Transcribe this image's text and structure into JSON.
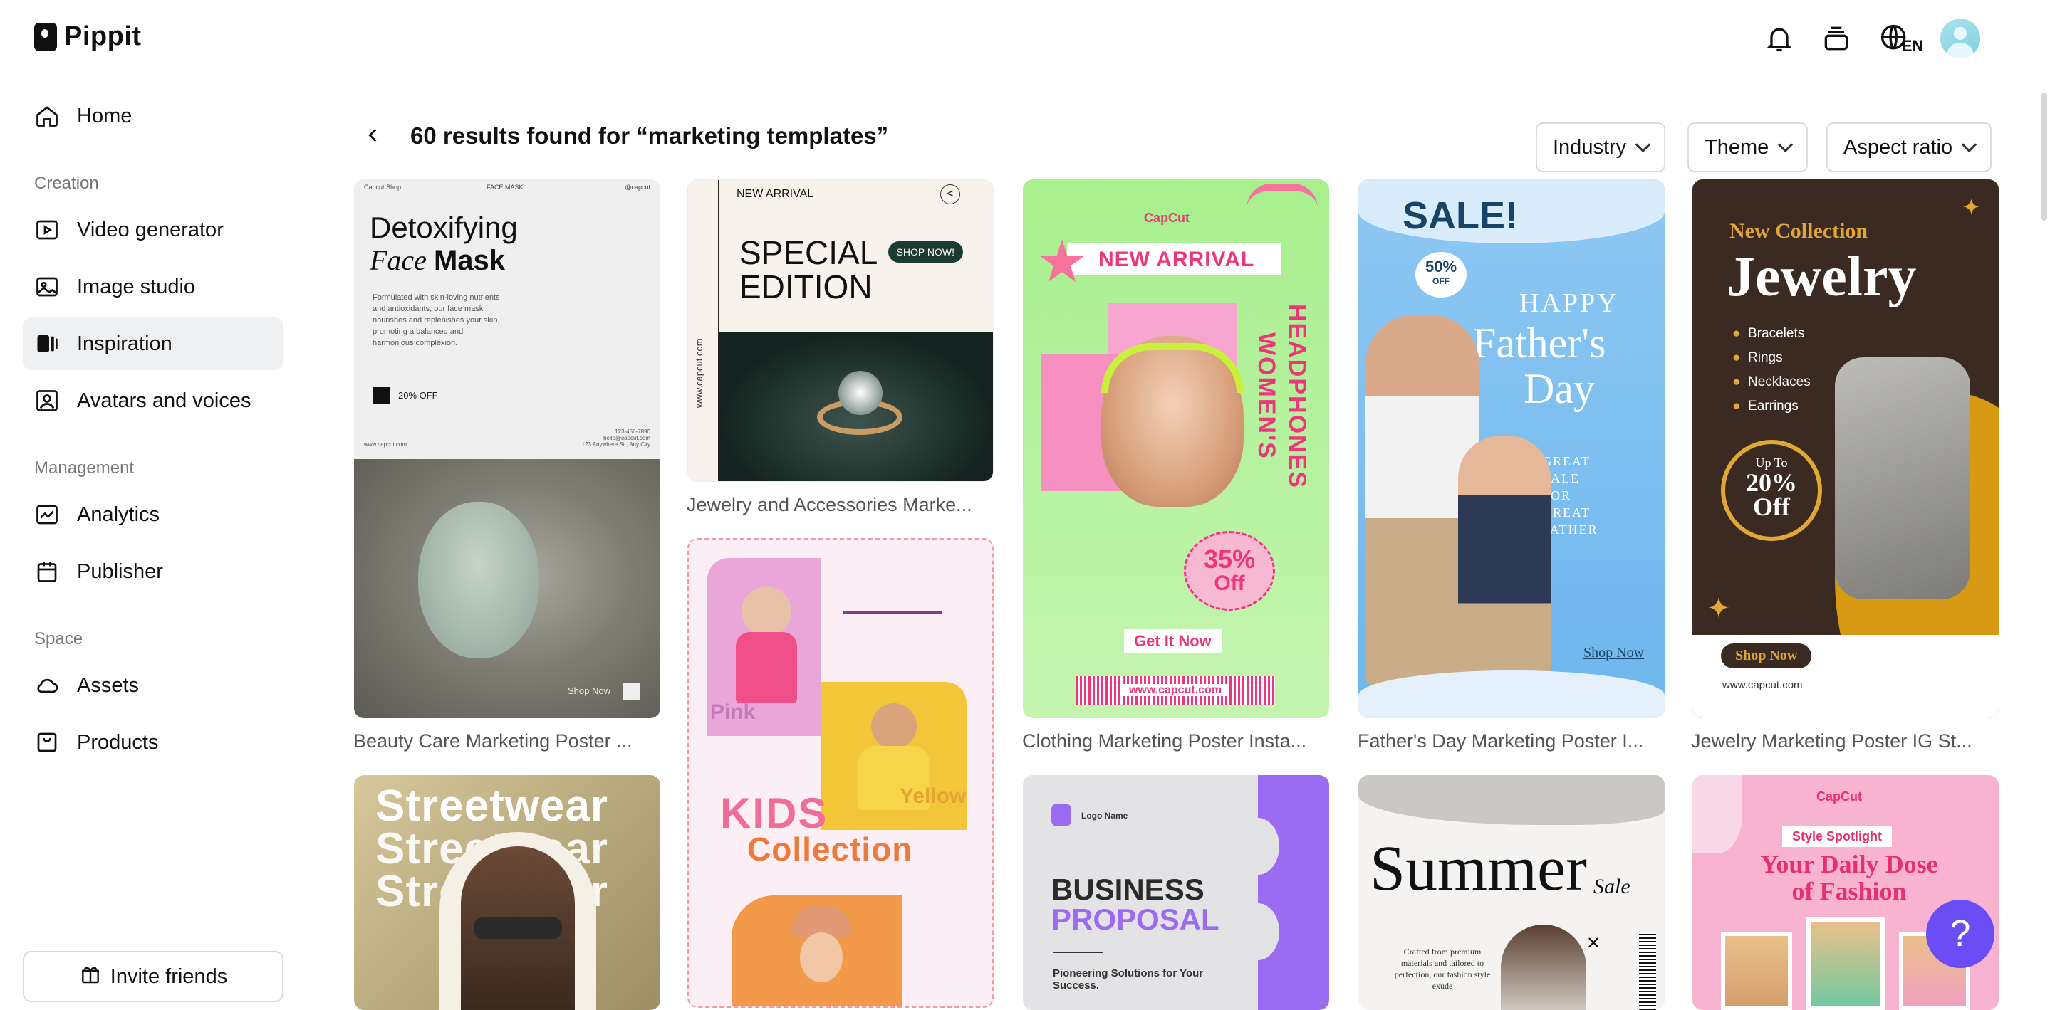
{
  "app": {
    "name": "Pippit"
  },
  "sidebar": {
    "home": "Home",
    "sections": [
      {
        "label": "Creation",
        "items": [
          "Video generator",
          "Image studio",
          "Inspiration",
          "Avatars and voices"
        ]
      },
      {
        "label": "Management",
        "items": [
          "Analytics",
          "Publisher"
        ]
      },
      {
        "label": "Space",
        "items": [
          "Assets",
          "Products"
        ]
      }
    ],
    "active_item": "Inspiration",
    "invite": "Invite friends"
  },
  "topbar": {
    "language": "EN",
    "icons": [
      "bell-icon",
      "stack-icon",
      "globe-icon",
      "avatar"
    ]
  },
  "results": {
    "text": "60 results found for “marketing templates”"
  },
  "filters": [
    "Industry",
    "Theme",
    "Aspect ratio"
  ],
  "cards": [
    {
      "title": "Beauty Care Marketing Poster ...",
      "art": {
        "brand": "Capcut Shop",
        "tag": "FACE MASK",
        "handle": "@capcut",
        "headline1": "Detoxifying",
        "headline2a": "Face",
        "headline2b": "Mask",
        "body": "Formulated with skin-loving nutrients and antioxidants, our face mask nourishes and replenishes your skin, promoting a balanced and harmonious complexion.",
        "discount": "20% OFF",
        "site": "www.capcut.com",
        "contact": "123-456-7890\nhello@capcut.com\n123 Anywhere St., Any City",
        "cta": "Shop Now"
      }
    },
    {
      "title": "Jewelry and Accessories Marke...",
      "art": {
        "tag": "NEW ARRIVAL",
        "headline": "SPECIAL\nEDITION",
        "cta": "SHOP NOW!",
        "site": "www.capcut.com"
      }
    },
    {
      "title": "Clothing Marketing Poster Insta...",
      "art": {
        "brand": "CapCut",
        "tag": "NEW ARRIVAL",
        "vertical1": "WOMEN'S",
        "vertical2": "HEADPHONES",
        "discount1": "35%",
        "discount2": "Off",
        "cta": "Get It Now",
        "site": "www.capcut.com"
      }
    },
    {
      "title": "Father's Day Marketing Poster I...",
      "art": {
        "sale": "SALE!",
        "badge1": "50%",
        "badge2": "OFF",
        "line1": "HAPPY",
        "line2": "Father's",
        "line3": "Day",
        "sub": "GREAT\nSALE\nFOR\nGREAT\nFATHER",
        "cta": "Shop Now"
      }
    },
    {
      "title": "Jewelry Marketing Poster IG St...",
      "art": {
        "tag": "New Collection",
        "headline": "Jewelry",
        "items": [
          "Bracelets",
          "Rings",
          "Necklaces",
          "Earrings"
        ],
        "badge1": "Up To",
        "badge2": "20%",
        "badge3": "Off",
        "cta": "Shop Now",
        "site": "www.capcut.com"
      }
    }
  ],
  "card_kids": {
    "label1": "Pink",
    "label2": "Yellow",
    "headline1": "KIDS",
    "headline2": "Collection"
  },
  "row2": [
    {
      "headline": "Streetwear"
    },
    {
      "logo": "Logo Name",
      "line1": "BUSINESS",
      "line2": "PROPOSAL",
      "sub": "Pioneering Solutions for Your Success."
    },
    {
      "headline": "Summer",
      "script": "Sale",
      "body": "Crafted from premium materials and tailored to perfection, our fashion style exude",
      "vertical": "capcut.com"
    },
    {
      "brand": "CapCut",
      "tag": "Style Spotlight",
      "headline": "Your Daily Dose\nof Fashion"
    }
  ],
  "colors": {
    "accent": "#6a4df4",
    "active_bg": "#eff0f2"
  }
}
